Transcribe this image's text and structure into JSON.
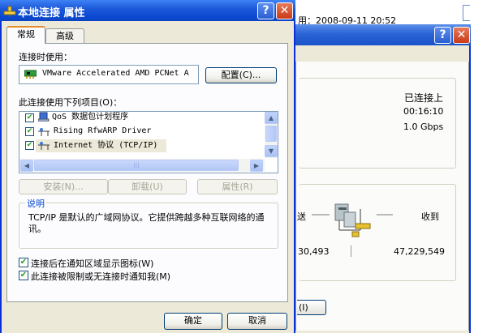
{
  "background_window": {
    "top_text": "用：2008-09-11 20:52",
    "help_glyph": "?",
    "close_glyph": "✕",
    "connection": {
      "status": "已连接上",
      "duration": "00:16:10",
      "speed": "1.0 Gbps"
    },
    "activity": {
      "sent_label": "送",
      "received_label": "收到",
      "sent_bytes": "30,493",
      "received_bytes": "47,229,549"
    },
    "button_fragment": "(I)"
  },
  "dialog": {
    "title": "本地连接 属性",
    "help_glyph": "?",
    "close_glyph": "✕",
    "tabs": [
      {
        "label": "常规",
        "selected": true
      },
      {
        "label": "高级",
        "selected": false
      }
    ],
    "connect_using_label": "连接时使用：",
    "adapter_name": "VMware Accelerated AMD PCNet A",
    "configure_label": "配置(C)...",
    "items_label": "此连接使用下列项目(O)：",
    "items": [
      {
        "label": "QoS 数据包计划程序",
        "checked": true,
        "icon": "qos-scheduler-icon"
      },
      {
        "label": "Rising RfwARP Driver",
        "checked": true,
        "icon": "network-protocol-icon"
      },
      {
        "label": "Internet 协议 (TCP/IP)",
        "checked": true,
        "icon": "network-protocol-icon",
        "selected": true
      }
    ],
    "install_label": "安装(N)...",
    "uninstall_label": "卸载(U)",
    "properties_label": "属性(R)",
    "description_title": "说明",
    "description_text": "TCP/IP 是默认的广域网协议。它提供跨越多种互联网络的通讯。",
    "notify_icon_label": "连接后在通知区域显示图标(W)",
    "notify_limited_label": "此连接被限制或无连接时通知我(M)",
    "notify_icon_checked": true,
    "notify_limited_checked": true,
    "ok_label": "确定",
    "cancel_label": "取消"
  },
  "colors": {
    "titlebar_blue": "#0a48d2",
    "dialog_face": "#ece9d8",
    "groupbox_title": "#0046d5",
    "checkmark_green": "#21a121",
    "tab_highlight": "#e68b2c"
  }
}
